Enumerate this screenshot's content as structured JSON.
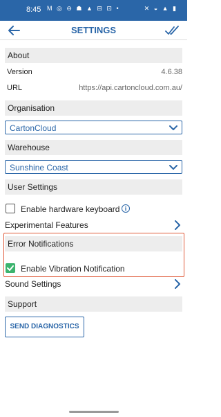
{
  "status_bar": {
    "time": "8:45",
    "left_icons": "M ◎ ⊖ ☗ ▲ ⊟ ⊡ •",
    "right_icons": "✕ ◒ ▲ ▮"
  },
  "app_bar": {
    "title": "SETTINGS"
  },
  "about": {
    "header": "About",
    "version_label": "Version",
    "version_value": "4.6.38",
    "url_label": "URL",
    "url_value": "https://api.cartoncloud.com.au/"
  },
  "organisation": {
    "header": "Organisation",
    "selected": "CartonCloud"
  },
  "warehouse": {
    "header": "Warehouse",
    "selected": "Sunshine Coast"
  },
  "user_settings": {
    "header": "User Settings",
    "hardware_keyboard_label": "Enable hardware keyboard",
    "hardware_keyboard_checked": false
  },
  "experimental": {
    "label": "Experimental Features"
  },
  "error_notifications": {
    "header": "Error Notifications",
    "vibration_label": "Enable Vibration Notification",
    "vibration_checked": true
  },
  "sound": {
    "label": "Sound Settings"
  },
  "support": {
    "header": "Support",
    "diagnostics_button": "SEND DIAGNOSTICS"
  },
  "colors": {
    "primary": "#2a66a8",
    "check_on": "#3cb46e",
    "highlight": "#e05a3a",
    "section_bg": "#ededed"
  },
  "icons": [
    "back-arrow-icon",
    "double-check-icon",
    "chevron-down-icon",
    "info-icon",
    "chevron-right-icon"
  ]
}
